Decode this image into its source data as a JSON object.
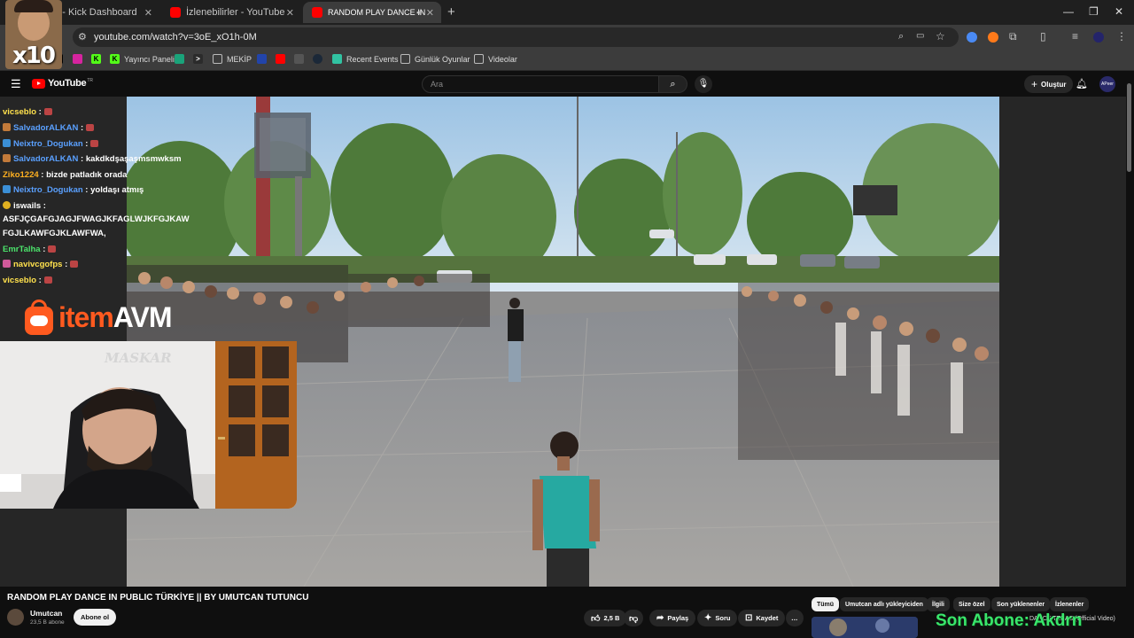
{
  "browser": {
    "tabs": [
      {
        "label": "m - Kick Dashboard",
        "favicon_color": "#53fc18"
      },
      {
        "label": "İzlenebilirler - YouTube",
        "favicon_color": "#ff0000"
      },
      {
        "label": "RANDOM PLAY DANCE IN",
        "favicon_color": "#ff0000",
        "active": true
      }
    ],
    "new_tab_icon": "+",
    "window_controls": [
      "—",
      "❐",
      "✕"
    ],
    "url": "youtube.com/watch?v=3oE_xO1h-0M",
    "bookmarks": [
      {
        "label": "",
        "icon": "x-icon",
        "color": "#000000"
      },
      {
        "label": "",
        "icon": "instagram-icon",
        "color": "#d6249f"
      },
      {
        "label": "",
        "icon": "kick-icon",
        "color": "#53fc18"
      },
      {
        "label": "Yayıncı Paneli",
        "icon": "kick-icon",
        "color": "#53fc18"
      },
      {
        "label": "",
        "icon": "app-icon",
        "color": "#1aa37a"
      },
      {
        "label": "",
        "icon": "terminal-icon",
        "color": "#2b2b2b"
      },
      {
        "label": "MEKİP",
        "icon": "folder-icon",
        "color": "#3c3c3c"
      },
      {
        "label": "",
        "icon": "app-icon",
        "color": "#2244aa"
      },
      {
        "label": "",
        "icon": "youtube-icon",
        "color": "#ff0000"
      },
      {
        "label": "",
        "icon": "image-icon",
        "color": "#444444"
      },
      {
        "label": "",
        "icon": "steam-icon",
        "color": "#1b2838"
      },
      {
        "label": "Recent Events",
        "icon": "streamlabs-icon",
        "color": "#31c3a2"
      },
      {
        "label": "Günlük Oyunlar",
        "icon": "folder-icon",
        "color": "#3c3c3c"
      },
      {
        "label": "Videolar",
        "icon": "folder-icon",
        "color": "#3c3c3c"
      }
    ]
  },
  "youtube": {
    "logo_text": "YouTube",
    "logo_region": "TR",
    "search_placeholder": "Ara",
    "create_label": "Oluştur",
    "avatar_text": "APeer"
  },
  "overlay": {
    "emote_label": "x10",
    "chat": [
      {
        "user": "vicseblo",
        "sep": " :",
        "msg": "",
        "color": "#ffe14d",
        "badge": "",
        "emote": true
      },
      {
        "user": "SalvadorALKAN",
        "sep": " :",
        "msg": "",
        "color": "#5aa0ff",
        "badge": "#c27a3a",
        "emote": true
      },
      {
        "user": "Neixtro_Dogukan",
        "sep": " :",
        "msg": "",
        "color": "#5aa0ff",
        "badge": "#3b8fd6",
        "emote": true
      },
      {
        "user": "SalvadorALKAN",
        "sep": " :",
        "msg": " kakdkdşaşaşmsmwksm",
        "color": "#5aa0ff",
        "badge": "#c27a3a",
        "emote": false
      },
      {
        "user": "Ziko1224",
        "sep": " :",
        "msg": " bizde patladık orada",
        "color": "#ffb020",
        "badge": "",
        "emote": false
      },
      {
        "user": "Neixtro_Dogukan",
        "sep": " :",
        "msg": " yoldaşı atmış",
        "color": "#5aa0ff",
        "badge": "#3b8fd6",
        "emote": false
      },
      {
        "user": "iswails",
        "sep": " :",
        "msg": "",
        "color": "#ffffff",
        "badge": "#e0b020",
        "emote": false
      },
      {
        "user": "",
        "sep": "",
        "msg": "ASFJÇGAFGJAGJFWAGJKFAGLWJKFGJKAW",
        "color": "#ffffff",
        "badge": "",
        "emote": false
      },
      {
        "user": "",
        "sep": "",
        "msg": "FGJLKAWFGJKLAWFWA,",
        "color": "#ffffff",
        "badge": "",
        "emote": false
      },
      {
        "user": "EmrTalha",
        "sep": " :",
        "msg": "",
        "color": "#4be36b",
        "badge": "",
        "emote": true
      },
      {
        "user": "navivcgofps",
        "sep": " :",
        "msg": "",
        "color": "#ffe14d",
        "badge": "#d05a9a",
        "emote": true
      },
      {
        "user": "vicseblo",
        "sep": " :",
        "msg": "",
        "color": "#ffe14d",
        "badge": "",
        "emote": true
      }
    ],
    "sponsor_item": "item",
    "sponsor_avm": "AVM",
    "webcam_wall_text": "MASKAR",
    "last_sub": "Son Abone: Akdrn"
  },
  "video": {
    "title": "RANDOM PLAY DANCE IN PUBLIC TÜRKİYE || BY UMUTCAN TUTUNCU",
    "channel": "Umutcan",
    "subscribers": "23,5 B abone",
    "subscribe_label": "Abone ol",
    "likes": "2,5 B",
    "share_label": "Paylaş",
    "ask_label": "Soru",
    "save_label": "Kaydet",
    "more_label": "…"
  },
  "recommendations": {
    "chips": [
      "Tümü",
      "Umutcan adlı yükleyiciden",
      "İlgili",
      "Size özel",
      "Son yüklenenler",
      "İzlenenler"
    ],
    "first_item_text": "DANCE TEXAS (Official Video)"
  },
  "colors": {
    "youtube_red": "#ff0000",
    "chrome_dark": "#1f1f1f",
    "chrome_mid": "#3c3c3c",
    "page_bg": "#0f0f0f",
    "sponsor_orange": "#ff5a1f",
    "sub_green": "#39e66b"
  }
}
